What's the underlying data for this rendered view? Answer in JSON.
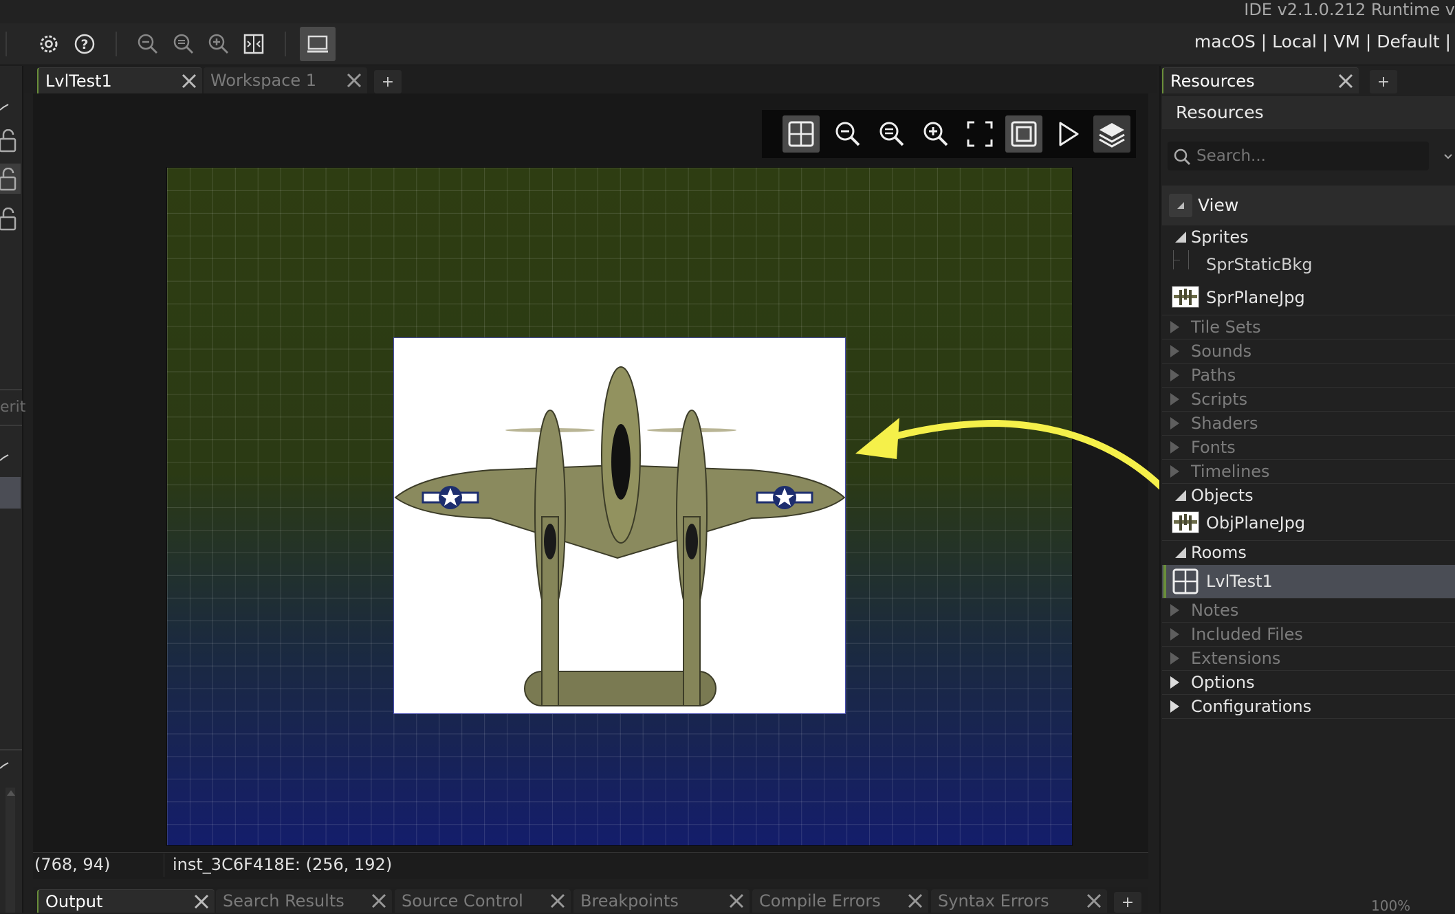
{
  "title_bar": {
    "ide_version": "IDE v2.1.0.212 Runtime v"
  },
  "toolbar": {
    "target_summary": "macOS | Local | VM | Default |",
    "icons": [
      "gear-icon",
      "help-icon",
      "zoom-out-icon",
      "zoom-reset-icon",
      "zoom-in-icon",
      "workspace-icon",
      "monitor-icon"
    ]
  },
  "workspace_tabs": [
    {
      "label": "LvlTest1",
      "active": true
    },
    {
      "label": "Workspace 1",
      "active": false
    }
  ],
  "add_tab_label": "+",
  "room_toolbar": {
    "icons": [
      "grid-toggle-icon",
      "zoom-out-icon",
      "zoom-reset-icon",
      "zoom-in-icon",
      "fullscreen-icon",
      "frame-icon",
      "play-icon",
      "layers-icon"
    ]
  },
  "left_strip": {
    "partial_label": "erit"
  },
  "status": {
    "cursor_position": "(768, 94)",
    "instance_info": "inst_3C6F418E: (256, 192)"
  },
  "output_tabs": [
    "Output",
    "Search Results",
    "Source Control",
    "Breakpoints",
    "Compile Errors",
    "Syntax Errors"
  ],
  "zoom_percent": "100%",
  "resources": {
    "tab_label": "Resources",
    "header": "Resources",
    "search_placeholder": "Search...",
    "view_label": "View",
    "groups": {
      "sprites": {
        "label": "Sprites",
        "items": [
          "SprStaticBkg",
          "SprPlaneJpg"
        ]
      },
      "tile_sets": "Tile Sets",
      "sounds": "Sounds",
      "paths": "Paths",
      "scripts": "Scripts",
      "shaders": "Shaders",
      "fonts": "Fonts",
      "timelines": "Timelines",
      "objects": {
        "label": "Objects",
        "items": [
          "ObjPlaneJpg"
        ]
      },
      "rooms": {
        "label": "Rooms",
        "items": [
          "LvlTest1"
        ]
      },
      "notes": "Notes",
      "included_files": "Included Files",
      "extensions": "Extensions",
      "options": "Options",
      "configurations": "Configurations"
    }
  },
  "colors": {
    "accent_green": "#6a8f3a",
    "arrow_yellow": "#f5f04a",
    "selected_row": "#4a4d55",
    "room_top": "#2e3d12",
    "room_bottom": "#141d6b"
  }
}
